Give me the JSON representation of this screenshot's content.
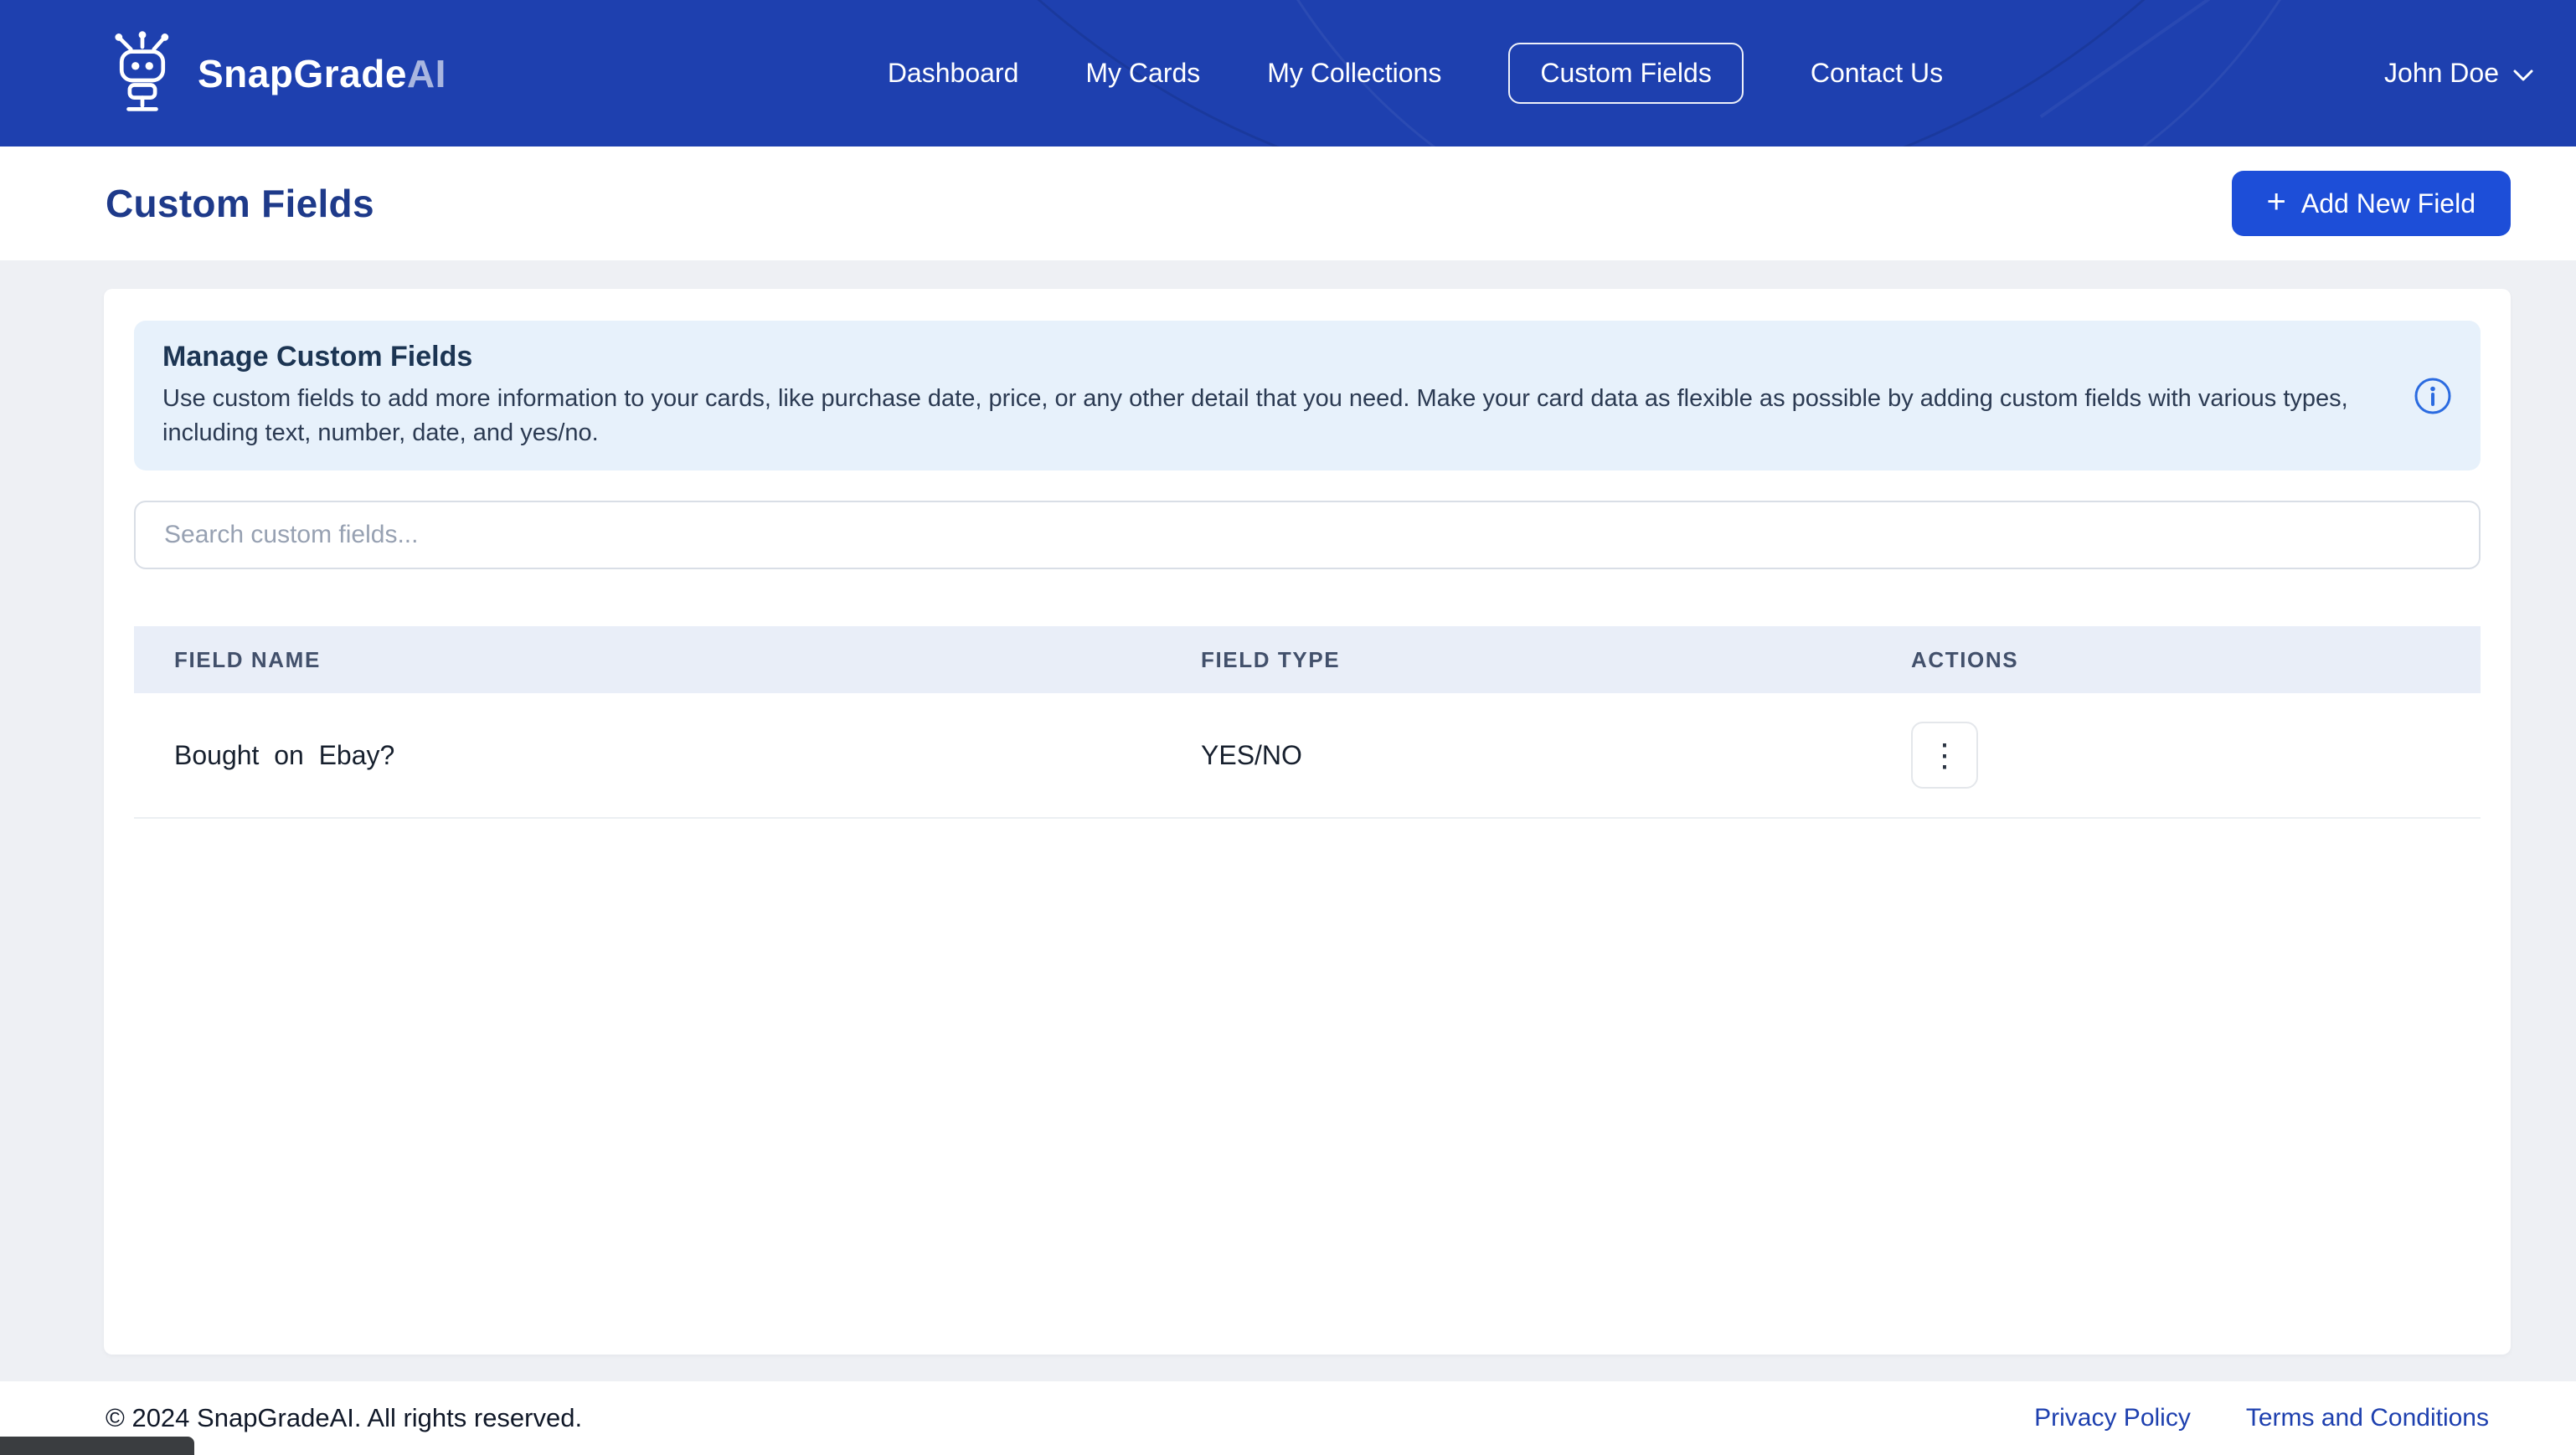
{
  "navbar": {
    "brand": {
      "name_primary": "SnapGrade",
      "name_secondary": "AI"
    },
    "items": [
      {
        "label": "Dashboard",
        "active": false
      },
      {
        "label": "My Cards",
        "active": false
      },
      {
        "label": "My Collections",
        "active": false
      },
      {
        "label": "Custom Fields",
        "active": true
      },
      {
        "label": "Contact Us",
        "active": false
      }
    ],
    "user": {
      "name": "John Doe"
    }
  },
  "page_header": {
    "title": "Custom Fields",
    "add_button_label": "Add New Field"
  },
  "banner": {
    "title": "Manage Custom Fields",
    "description": "Use custom fields to add more information to your cards, like purchase date, price, or any other detail that you need. Make your card data as flexible as possible by adding custom fields with various types, including text, number, date, and yes/no."
  },
  "search": {
    "placeholder": "Search custom fields..."
  },
  "table": {
    "columns": [
      "FIELD NAME",
      "FIELD TYPE",
      "ACTIONS"
    ],
    "rows": [
      {
        "field_name": "Bought  on  Ebay?",
        "field_type": "YES/NO"
      }
    ]
  },
  "footer": {
    "copyright": "© 2024 SnapGradeAI. All rights reserved.",
    "links": [
      {
        "label": "Privacy Policy"
      },
      {
        "label": "Terms and Conditions"
      }
    ]
  },
  "icons": {
    "logo": "robot",
    "add": "+",
    "row_actions": "⋮",
    "user_chevron": "chevron-down",
    "banner_info": "info-circle"
  },
  "colors": {
    "navbar_bg": "#1e40af",
    "accent_button": "#1d4ed8",
    "heading_navy": "#1e3a8a",
    "banner_bg": "#e7f1fb",
    "table_header_bg": "#e9eef8",
    "page_bg": "#eef0f4",
    "footer_link": "#1e40af",
    "info_icon": "#2b6be0"
  }
}
